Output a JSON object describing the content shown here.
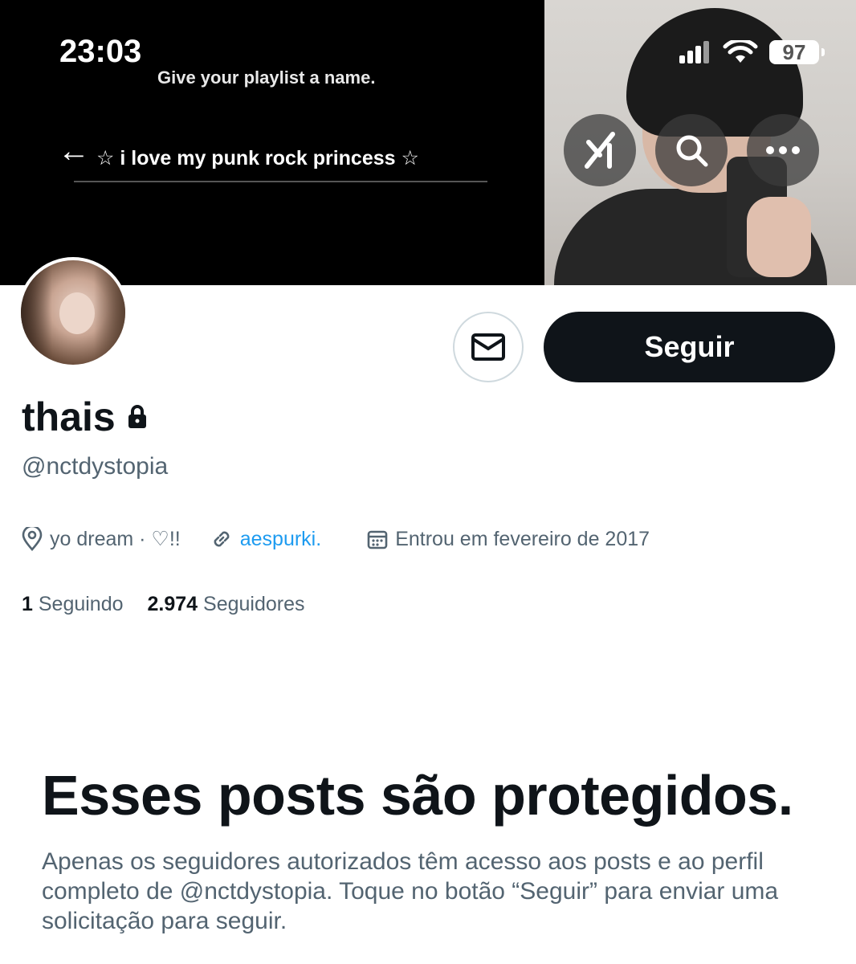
{
  "status_bar": {
    "time": "23:03",
    "battery": "97"
  },
  "banner": {
    "prompt": "Give your playlist a name.",
    "playlist_name": "☆ i love my punk rock princess ☆",
    "back_icon": "arrow-left-icon"
  },
  "header_actions": {
    "grok_icon": "grok-icon",
    "search_icon": "search-icon",
    "more_icon": "more-icon"
  },
  "profile": {
    "name": "thais",
    "handle": "@nctdystopia",
    "location": "yo dream · ♡!!",
    "link": "aespurki.",
    "joined": "Entrou em fevereiro de 2017",
    "following_count": "1",
    "following_label": "Seguindo",
    "followers_count": "2.974",
    "followers_label": "Seguidores"
  },
  "actions": {
    "follow_label": "Seguir"
  },
  "protected": {
    "title": "Esses posts são protegidos.",
    "text": "Apenas os seguidores autorizados têm acesso aos posts e ao perfil completo de @nctdystopia. Toque no botão “Seguir” para enviar uma solicitação para seguir."
  },
  "colors": {
    "text_primary": "#0f1419",
    "text_secondary": "#536471",
    "link": "#1d9bf0"
  }
}
